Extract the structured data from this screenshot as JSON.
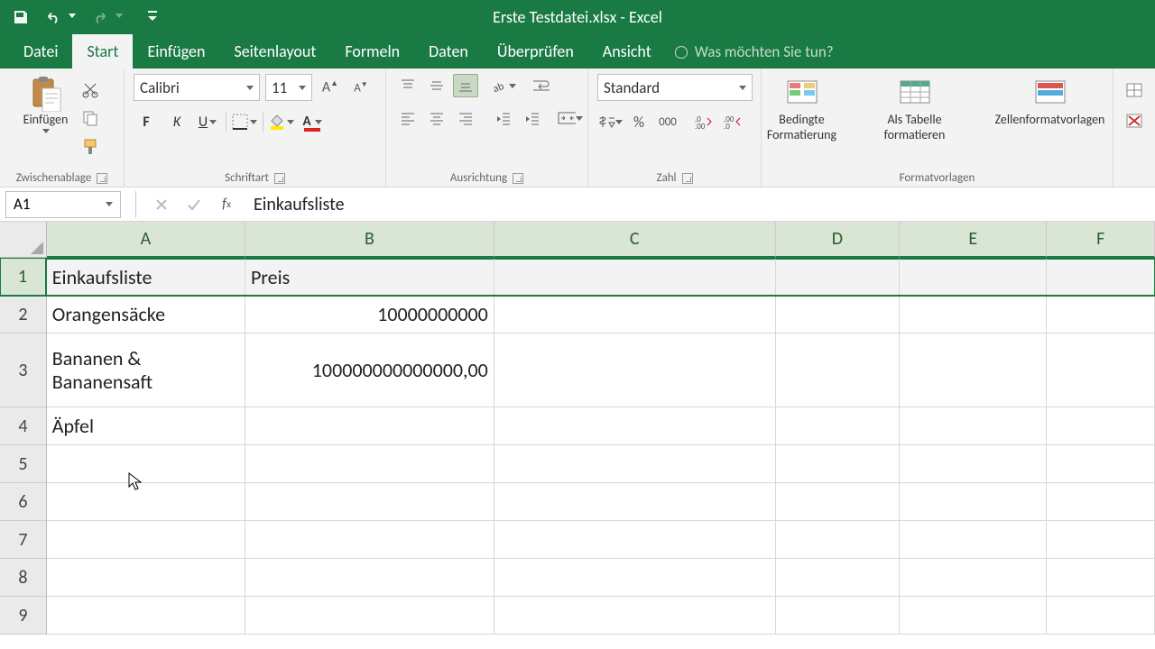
{
  "app": {
    "title": "Erste Testdatei.xlsx - Excel"
  },
  "tabs": {
    "file": "Datei",
    "home": "Start",
    "insert": "Einfügen",
    "pagelayout": "Seitenlayout",
    "formulas": "Formeln",
    "data": "Daten",
    "review": "Überprüfen",
    "view": "Ansicht",
    "tellme": "Was möchten Sie tun?"
  },
  "ribbon": {
    "clipboard": {
      "paste": "Einfügen",
      "group": "Zwischenablage"
    },
    "font": {
      "name": "Calibri",
      "size": "11",
      "bold": "F",
      "italic": "K",
      "underline": "U",
      "group": "Schriftart"
    },
    "alignment": {
      "group": "Ausrichtung"
    },
    "number": {
      "format": "Standard",
      "group": "Zahl"
    },
    "styles": {
      "conditional": "Bedingte Formatierung",
      "table": "Als Tabelle formatieren",
      "cellstyles": "Zellenformatvorlagen",
      "group": "Formatvorlagen"
    }
  },
  "namebox": "A1",
  "formula": "Einkaufsliste",
  "columns": [
    "A",
    "B",
    "C",
    "D",
    "E",
    "F"
  ],
  "rows": [
    1,
    2,
    3,
    4,
    5,
    6,
    7,
    8,
    9
  ],
  "row_heights": {
    "1": 42,
    "2": 42,
    "3": 82,
    "default": 42
  },
  "cells": {
    "A1": "Einkaufsliste",
    "B1": "Preis",
    "A2": "Orangensäcke",
    "B2": "10000000000",
    "A3": "Bananen & Bananensaft",
    "B3": "100000000000000,00",
    "A4": "Äpfel"
  },
  "selection": {
    "type": "row",
    "row": 1,
    "active": "A1"
  },
  "number_format_pct": "%",
  "number_format_000": "000"
}
